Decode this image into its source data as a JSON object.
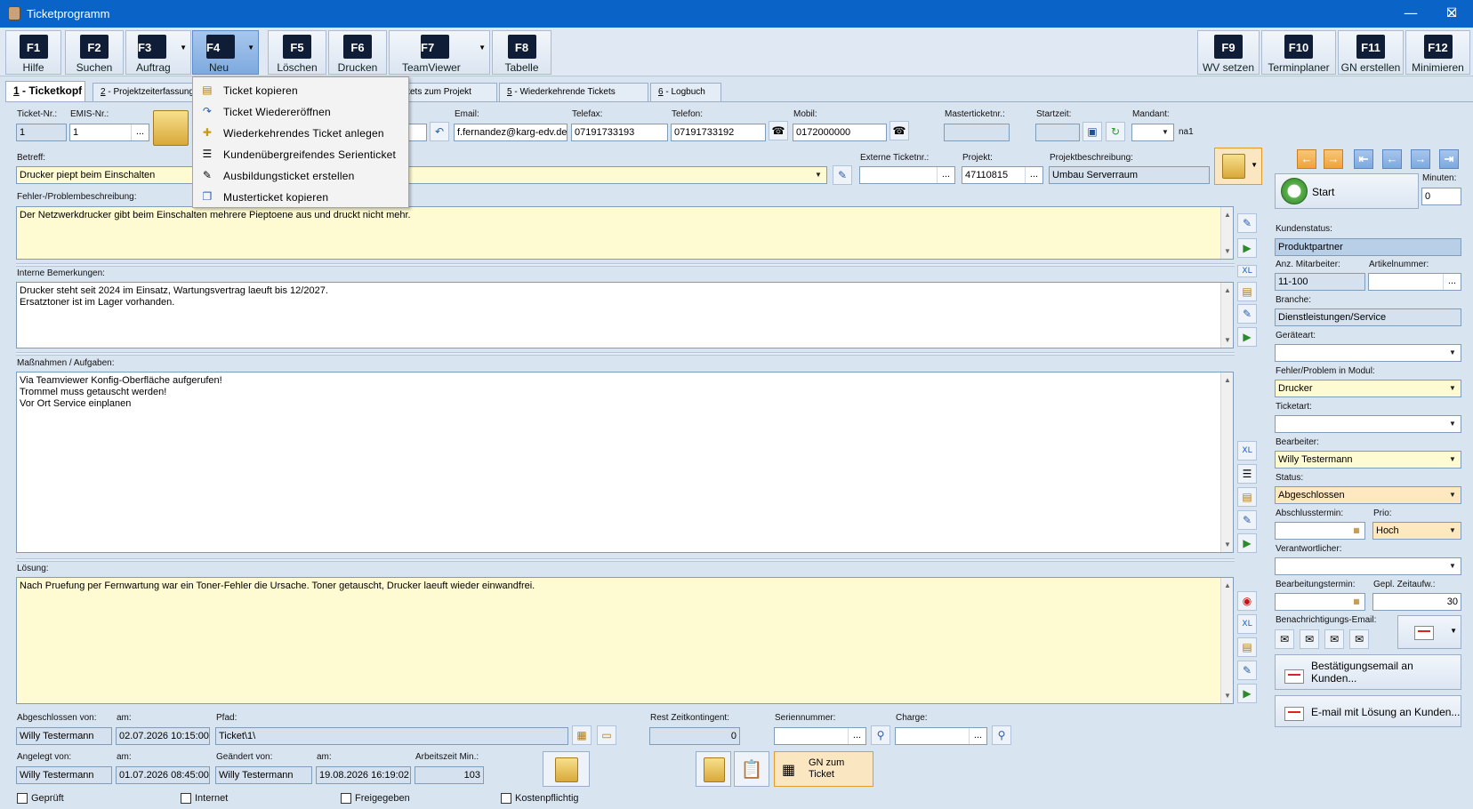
{
  "window": {
    "title": "Ticketprogramm",
    "min": "—",
    "max": "☐",
    "close": "✕"
  },
  "toolbar": {
    "keys": [
      {
        "key": "F1",
        "label": "Hilfe"
      },
      {
        "key": "F2",
        "label": "Suchen"
      },
      {
        "key": "F3",
        "label": "Auftrag"
      },
      {
        "key": "F4",
        "label": "Neu"
      },
      {
        "key": "F5",
        "label": "Löschen"
      },
      {
        "key": "F6",
        "label": "Drucken"
      },
      {
        "key": "F7",
        "label": "TeamViewer"
      },
      {
        "key": "F8",
        "label": "Tabelle"
      },
      {
        "key": "F9",
        "label": "WV setzen"
      },
      {
        "key": "F10",
        "label": "Terminplaner"
      },
      {
        "key": "F11",
        "label": "GN erstellen"
      },
      {
        "key": "F12",
        "label": "Minimieren"
      }
    ]
  },
  "tabs": [
    {
      "num": "1",
      "label": " - Ticketkopf"
    },
    {
      "num": "2",
      "label": " - Projektzeiterfassung"
    },
    {
      "num": "",
      "label": "kets zum Projekt"
    },
    {
      "num": "5",
      "label": " - Wiederkehrende Tickets"
    },
    {
      "num": "6",
      "label": " - Logbuch"
    }
  ],
  "menu": {
    "items": [
      "Ticket kopieren",
      "Ticket Wiedereröffnen",
      "Wiederkehrendes Ticket anlegen",
      "Kundenübergreifendes Serienticket",
      "Ausbildungsticket erstellen",
      "Musterticket kopieren"
    ]
  },
  "head": {
    "ticketnr_label": "Ticket-Nr.:",
    "ticketnr": "1",
    "emis_label": "EMIS-Nr.:",
    "emis": "1",
    "email_label": "Email:",
    "email": "f.fernandez@karg-edv.de",
    "telefax_label": "Telefax:",
    "telefax": "07191733193",
    "telefon_label": "Telefon:",
    "telefon": "07191733192",
    "mobil_label": "Mobil:",
    "mobil": "0172000000",
    "master_label": "Masterticketnr.:",
    "master": "",
    "startzeit_label": "Startzeit:",
    "startzeit": "",
    "mandant_label": "Mandant:",
    "mandant": "",
    "mandant_suffix": "na1"
  },
  "betreff": {
    "label": "Betreff:",
    "value": "Drucker piept beim Einschalten"
  },
  "extern": {
    "label": "Externe Ticketnr.:",
    "value": ""
  },
  "projekt": {
    "label": "Projekt:",
    "value": "47110815"
  },
  "projektbeschr": {
    "label": "Projektbeschreibung:",
    "value": "Umbau Serverraum"
  },
  "fehler": {
    "label": "Fehler-/Problembeschreibung:",
    "text": "Der Netzwerkdrucker gibt beim Einschalten mehrere Pieptoene aus und druckt nicht mehr."
  },
  "intern": {
    "label": "Interne Bemerkungen:",
    "text": "Drucker steht seit 2024 im Einsatz, Wartungsvertrag laeuft bis 12/2027.\nErsatztoner ist im Lager vorhanden."
  },
  "massnahmen": {
    "label": "Maßnahmen / Aufgaben:",
    "text": "Via Teamviewer Konfig-Oberfläche aufgerufen!\nTrommel muss getauscht werden!\nVor Ort Service einplanen"
  },
  "loesung": {
    "label": "Lösung:",
    "text": "Nach Pruefung per Fernwartung war ein Toner-Fehler die Ursache. Toner getauscht, Drucker laeuft wieder einwandfrei."
  },
  "bottom": {
    "abgeschl_von_label": "Abgeschlossen von:",
    "abgeschl_von": "Willy Testermann",
    "am_label": "am:",
    "abgeschl_am": "02.07.2026 10:15:00",
    "pfad_label": "Pfad:",
    "pfad": "Ticket\\1\\",
    "rest_label": "Rest Zeitkontingent:",
    "rest": "0",
    "serien_label": "Seriennummer:",
    "serien": "",
    "charge_label": "Charge:",
    "charge": "",
    "angelegt_label": "Angelegt von:",
    "angelegt": "Willy Testermann",
    "angelegt_am": "01.07.2026 08:45:00",
    "geaendert_label": "Geändert von:",
    "geaendert": "Willy Testermann",
    "geaendert_am": "19.08.2026 16:19:02",
    "arbeitszeit_label": "Arbeitszeit Min.:",
    "arbeitszeit": "103",
    "gn_button": "GN zum Ticket",
    "cb_geprueft": "Geprüft",
    "cb_internet": "Internet",
    "cb_freigegeben": "Freigegeben",
    "cb_kosten": "Kostenpflichtig"
  },
  "right": {
    "start": "Start",
    "minuten_label": "Minuten:",
    "minuten": "0",
    "kundenstatus_label": "Kundenstatus:",
    "kundenstatus": "Produktpartner",
    "mitarbeiter_label": "Anz. Mitarbeiter:",
    "mitarbeiter": "11-100",
    "artikel_label": "Artikelnummer:",
    "artikel": "",
    "branche_label": "Branche:",
    "branche": "Dienstleistungen/Service",
    "geraeteart_label": "Geräteart:",
    "geraeteart": "",
    "modul_label": "Fehler/Problem in Modul:",
    "modul": "Drucker",
    "ticketart_label": "Ticketart:",
    "ticketart": "",
    "bearbeiter_label": "Bearbeiter:",
    "bearbeiter": "Willy Testermann",
    "status_label": "Status:",
    "status": "Abgeschlossen",
    "abschluss_label": "Abschlusstermin:",
    "abschluss": "",
    "prio_label": "Prio:",
    "prio": "Hoch",
    "verantw_label": "Verantwortlicher:",
    "verantw": "",
    "bearbtermin_label": "Bearbeitungstermin:",
    "bearbtermin": "",
    "zeitaufw_label": "Gepl. Zeitaufw.:",
    "zeitaufw": "30",
    "benach_label": "Benachrichtigungs-Email:",
    "bestaetigung": "Bestätigungsemail an Kunden...",
    "mailloesung": "E-mail mit Lösung an Kunden..."
  }
}
